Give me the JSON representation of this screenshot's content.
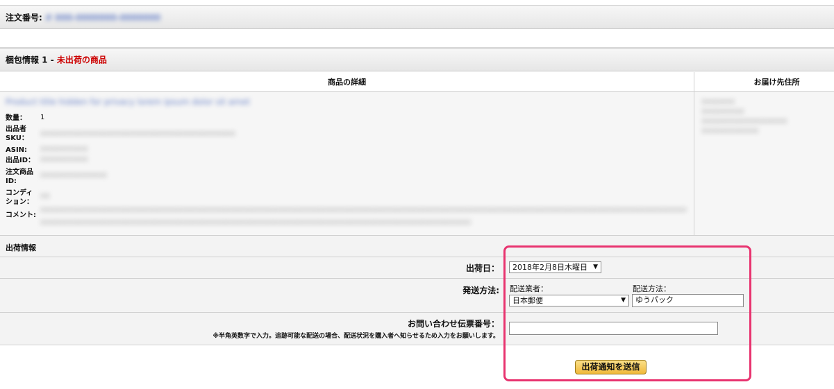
{
  "order": {
    "label": "注文番号:",
    "number": "# 000-0000000-0000000"
  },
  "package": {
    "title": "梱包情報 1",
    "separator": " - ",
    "status": "未出荷の商品"
  },
  "table": {
    "col_detail": "商品の詳細",
    "col_address": "お届け先住所"
  },
  "item": {
    "title": "Product title hidden for privacy lorem ipsum dolor sit amet",
    "labels": {
      "qty": "数量：",
      "seller_sku": "出品者SKU：",
      "asin": "ASIN:",
      "listing_id": "出品ID：",
      "order_item_id": "注文商品ID:",
      "condition": "コンディション：",
      "comment": "コメント:"
    },
    "values": {
      "qty": "1",
      "seller_sku": "XXXXXXXXXXXXXXXXXXXXXXXXXXXXXXXXXXXXXXXXX",
      "asin": "XXXXXXXXXX",
      "listing_id": "XXXXXXXXXX",
      "order_item_id": "XXXXXXXXXXXXXX",
      "condition": "XX",
      "comment_line1": "XXXXXXXXXXXXXXXXXXXXXXXXXXXXXXXXXXXXXXXXXXXXXXXXXXXXXXXXXXXXXXXXXXXXXXXXXXXXXXXXXXXXXXXXXXXXXXXXXXXXXXXXXXXXXXXXXXXXXXXXXXXXXXXXXXXXXXXXXXXXXXXXXXXXXXXXXXXXXXXXXXXXX",
      "comment_line2": "XXXXXXXXXXXXXXXXXXXXXXXXXXXXXXXXXXXXXXXXXXXXXXXXXXXXXXXXXXXXXXXXXXXXXXXXXXXXXXXXXXXXXXXXXXXXXX"
    }
  },
  "address": {
    "line1": "XXXXXXX",
    "line2": "XXXXXXXXX",
    "line3": "XXXXXXXXXXXXXXXXXX",
    "line4": "XXXXXXXXXXXX"
  },
  "shipping": {
    "section_title": "出荷情報",
    "ship_date_label": "出荷日：",
    "ship_date_value": "2018年2月8日木曜日",
    "method_label": "発送方法:",
    "carrier_label": "配送業者：",
    "carrier_value": "日本郵便",
    "service_label": "配送方法：",
    "service_value": "ゆうパック",
    "tracking_label": "お問い合わせ伝票番号：",
    "tracking_note": "※半角英数字で入力。追跡可能な配送の場合、配送状況を購入者へ知らせるため入力をお願いします。",
    "tracking_value": "",
    "submit_label": "出荷通知を送信"
  }
}
